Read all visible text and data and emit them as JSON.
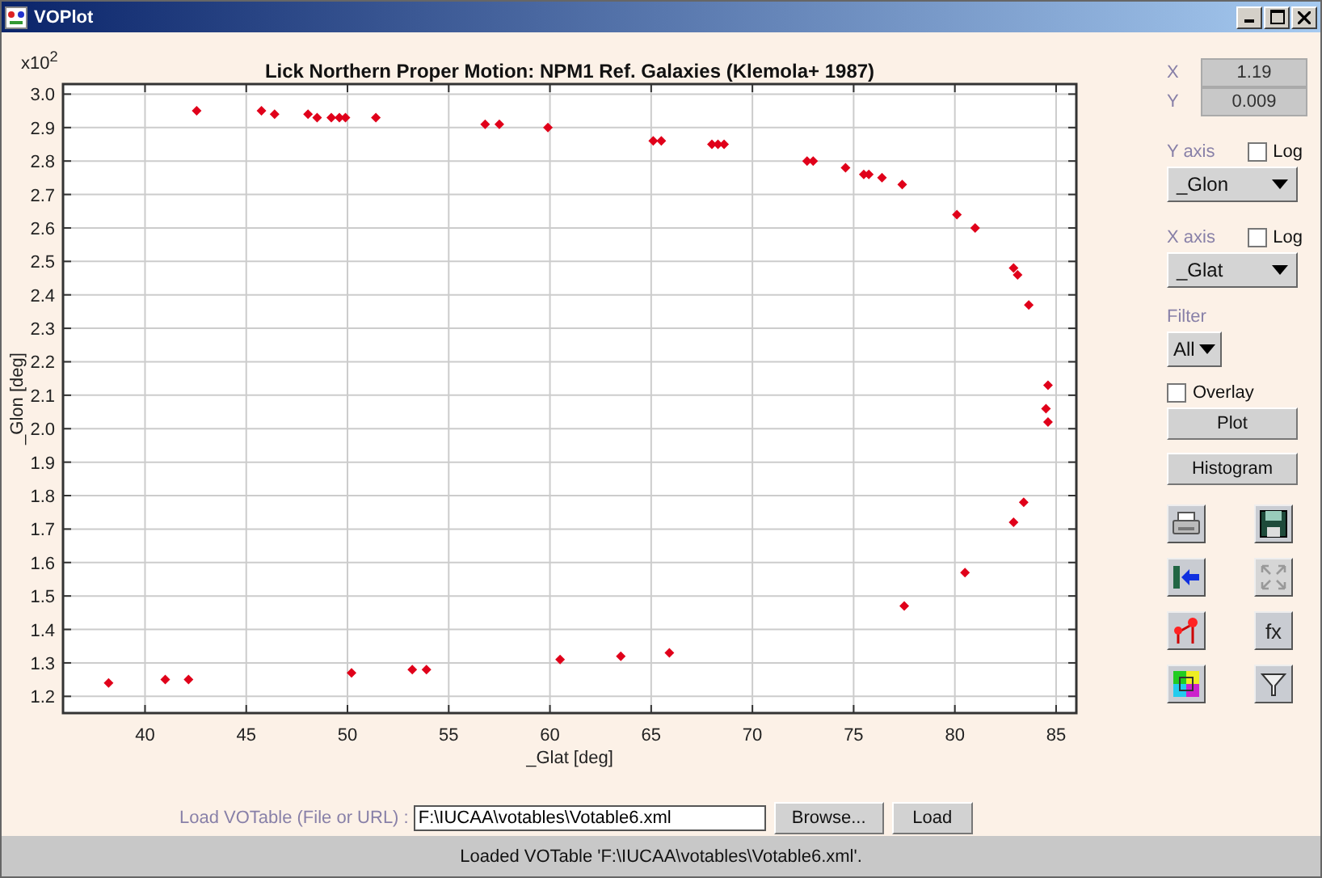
{
  "window": {
    "title": "VOPlot"
  },
  "chart": {
    "scale_label": "x10$^{2}$",
    "chart_data": {
      "type": "scatter",
      "grid": true,
      "title": "Lick Northern Proper Motion: NPM1 Ref. Galaxies (Klemola+ 1987)",
      "xlabel": "_Glat [deg]",
      "ylabel": "_Glon [deg]",
      "xlim": [
        35.95,
        86.0
      ],
      "ylim": [
        1.15,
        3.03
      ],
      "xticks": [
        40,
        45,
        50,
        55,
        60,
        65,
        70,
        75,
        80,
        85
      ],
      "yticks": [
        {
          "value": 1.2,
          "label": "1.2"
        },
        {
          "value": 1.3,
          "label": "1.3"
        },
        {
          "value": 1.4,
          "label": "1.4"
        },
        {
          "value": 1.5,
          "label": "1.5"
        },
        {
          "value": 1.6,
          "label": "1.6"
        },
        {
          "value": 1.7,
          "label": "1.7"
        },
        {
          "value": 1.8,
          "label": "1.8"
        },
        {
          "value": 1.9,
          "label": "1.9"
        },
        {
          "value": 2.0,
          "label": "2.0"
        },
        {
          "value": 2.1,
          "label": "2.1"
        },
        {
          "value": 2.2,
          "label": "2.2"
        },
        {
          "value": 2.3,
          "label": "2.3"
        },
        {
          "value": 2.4,
          "label": "2.4"
        },
        {
          "value": 2.5,
          "label": "2.5"
        },
        {
          "value": 2.6,
          "label": "2.6"
        },
        {
          "value": 2.7,
          "label": "2.7"
        },
        {
          "value": 2.8,
          "label": "2.8"
        },
        {
          "value": 2.9,
          "label": "2.9"
        },
        {
          "value": 3.0,
          "label": "3.0"
        }
      ],
      "x": [
        38.2,
        41.0,
        42.15,
        42.55,
        45.75,
        46.4,
        48.05,
        48.5,
        49.2,
        49.6,
        49.9,
        51.4,
        50.2,
        53.2,
        53.9,
        56.8,
        57.5,
        59.9,
        60.5,
        63.5,
        65.9,
        65.1,
        65.5,
        68.0,
        68.3,
        68.6,
        72.7,
        73.0,
        74.6,
        75.5,
        75.75,
        76.4,
        77.4,
        77.5,
        80.1,
        81.0,
        80.5,
        82.9,
        83.1,
        83.65,
        82.9,
        83.4,
        84.6,
        84.5,
        84.6
      ],
      "series": [
        {
          "color": "#e0001a",
          "values": [
            1.24,
            1.25,
            1.25,
            2.95,
            2.95,
            2.94,
            2.94,
            2.93,
            2.93,
            2.93,
            2.93,
            2.93,
            1.27,
            1.28,
            1.28,
            2.91,
            2.91,
            2.9,
            1.31,
            1.32,
            1.33,
            2.86,
            2.86,
            2.85,
            2.85,
            2.85,
            2.8,
            2.8,
            2.78,
            2.76,
            2.76,
            2.75,
            2.73,
            1.47,
            2.64,
            2.6,
            1.57,
            2.48,
            2.46,
            2.37,
            1.72,
            1.78,
            2.13,
            2.06,
            2.02
          ]
        }
      ]
    }
  },
  "readouts": [
    {
      "label": "X",
      "value": "1.19"
    },
    {
      "label": "Y",
      "value": "0.009"
    }
  ],
  "y_axis": {
    "label": "Y axis",
    "log_label": "Log",
    "log": false,
    "selection": "_Glon"
  },
  "x_axis": {
    "label": "X axis",
    "log_label": "Log",
    "log": false,
    "selection": "_Glat"
  },
  "filter": {
    "label": "Filter",
    "selection": "All"
  },
  "overlay": {
    "label": "Overlay",
    "checked": false
  },
  "buttons": [
    "Plot",
    "Histogram"
  ],
  "tools": [
    {
      "kind": "print",
      "disabled": false
    },
    {
      "kind": "save",
      "disabled": false
    },
    {
      "kind": "import",
      "disabled": false
    },
    {
      "kind": "fit",
      "disabled": true
    },
    {
      "kind": "marker",
      "disabled": false
    },
    {
      "kind": "function",
      "label": "fx",
      "disabled": false
    },
    {
      "kind": "colors",
      "disabled": false
    },
    {
      "kind": "filter",
      "disabled": false
    }
  ],
  "load": {
    "label": "Load VOTable (File or URL) :",
    "value": "F:\\IUCAA\\votables\\Votable6.xml",
    "buttons": [
      "Browse...",
      "Load"
    ]
  },
  "status_bar": "Loaded VOTable 'F:\\IUCAA\\votables\\Votable6.xml'."
}
